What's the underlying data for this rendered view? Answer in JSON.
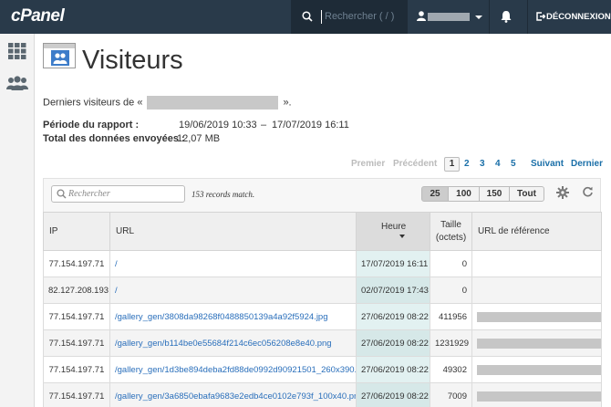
{
  "topbar": {
    "logo": "cPanel",
    "search_placeholder": "Rechercher ( / )",
    "logout_label": "DÉCONNEXION"
  },
  "page": {
    "title": "Visiteurs",
    "subtitle_prefix": "Derniers visiteurs de «",
    "subtitle_suffix": "».",
    "report_period_label": "Période du rapport :",
    "report_period_start": "19/06/2019 10:33",
    "report_period_sep": "–",
    "report_period_end": "17/07/2019 16:11",
    "total_data_label": "Total des données envoyées :",
    "total_data_value": "12,07 MB"
  },
  "pagination": {
    "first": "Premier",
    "prev": "Précédent",
    "pages": [
      "1",
      "2",
      "3",
      "4",
      "5"
    ],
    "current": "1",
    "next": "Suivant",
    "last": "Dernier"
  },
  "filter": {
    "placeholder": "Rechercher",
    "records_text": "153 records match.",
    "per_page": [
      "25",
      "100",
      "150",
      "Tout"
    ],
    "per_page_selected": "25"
  },
  "table": {
    "columns": {
      "ip": "IP",
      "url": "URL",
      "heure": "Heure",
      "taille_line1": "Taille",
      "taille_line2": "(octets)",
      "ref": "URL de référence"
    },
    "rows": [
      {
        "ip": "77.154.197.71",
        "url": "/",
        "heure": "17/07/2019 16:11",
        "size": "0"
      },
      {
        "ip": "82.127.208.193",
        "url": "/",
        "heure": "02/07/2019 17:43",
        "size": "0"
      },
      {
        "ip": "77.154.197.71",
        "url": "/gallery_gen/3808da98268f0488850139a4a92f5924.jpg",
        "heure": "27/06/2019 08:22",
        "size": "411956"
      },
      {
        "ip": "77.154.197.71",
        "url": "/gallery_gen/b114be0e55684f214c6ec056208e8e40.png",
        "heure": "27/06/2019 08:22",
        "size": "1231929"
      },
      {
        "ip": "77.154.197.71",
        "url": "/gallery_gen/1d3be894deba2fd88de0992d90921501_260x390.jpg",
        "heure": "27/06/2019 08:22",
        "size": "49302"
      },
      {
        "ip": "77.154.197.71",
        "url": "/gallery_gen/3a6850ebafa9683e2edb4ce0102e793f_100x40.png",
        "heure": "27/06/2019 08:22",
        "size": "7009"
      }
    ]
  },
  "colors": {
    "topbar_bg": "#293a4a",
    "link": "#2a6fbb",
    "sorted_column_bg": "#e2f1f1"
  },
  "icons": [
    "search-icon",
    "user-icon",
    "bell-icon",
    "logout-icon",
    "grid-icon",
    "users-icon",
    "visitors-icon",
    "gear-icon",
    "refresh-icon"
  ]
}
